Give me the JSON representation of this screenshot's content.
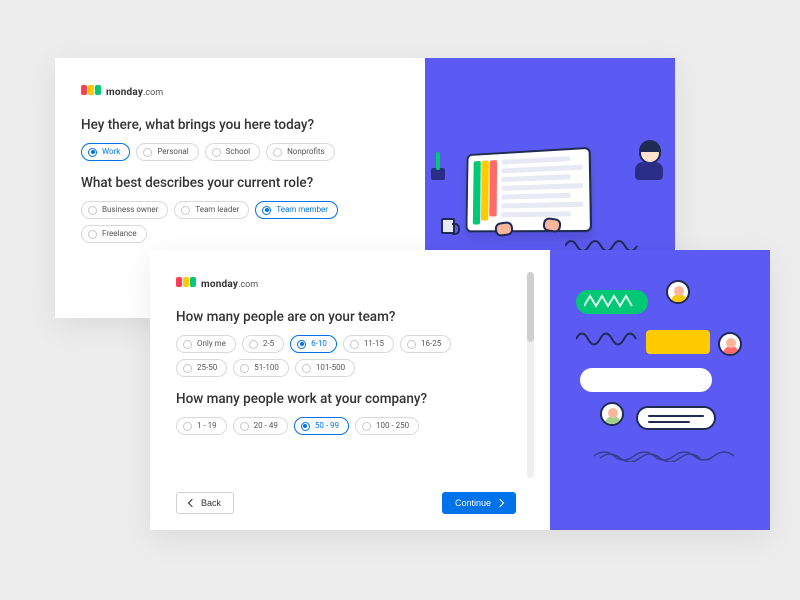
{
  "brand": {
    "name": "monday",
    "domain": ".com"
  },
  "colors": {
    "accent": "#0073ea",
    "panel": "#5b5bf3"
  },
  "card_a": {
    "q1": {
      "text": "Hey there, what brings you here today?",
      "selected": "Work",
      "options": [
        "Work",
        "Personal",
        "School",
        "Nonprofits"
      ]
    },
    "q2": {
      "text": "What best describes your current role?",
      "selected": "Team member",
      "row1": [
        "Business owner",
        "Team leader",
        "Team member"
      ],
      "row2": [
        "Freelance"
      ]
    }
  },
  "card_b": {
    "q1": {
      "text": "How many people are on your team?",
      "selected": "6-10",
      "row1": [
        "Only me",
        "2-5",
        "6-10",
        "11-15",
        "16-25"
      ],
      "row2": [
        "25-50",
        "51-100",
        "101-500"
      ]
    },
    "q2": {
      "text": "How many people work at your company?",
      "selected": "50 - 99",
      "options": [
        "1 - 19",
        "20 - 49",
        "50 - 99",
        "100 - 250"
      ]
    },
    "back_label": "Back",
    "continue_label": "Continue"
  }
}
